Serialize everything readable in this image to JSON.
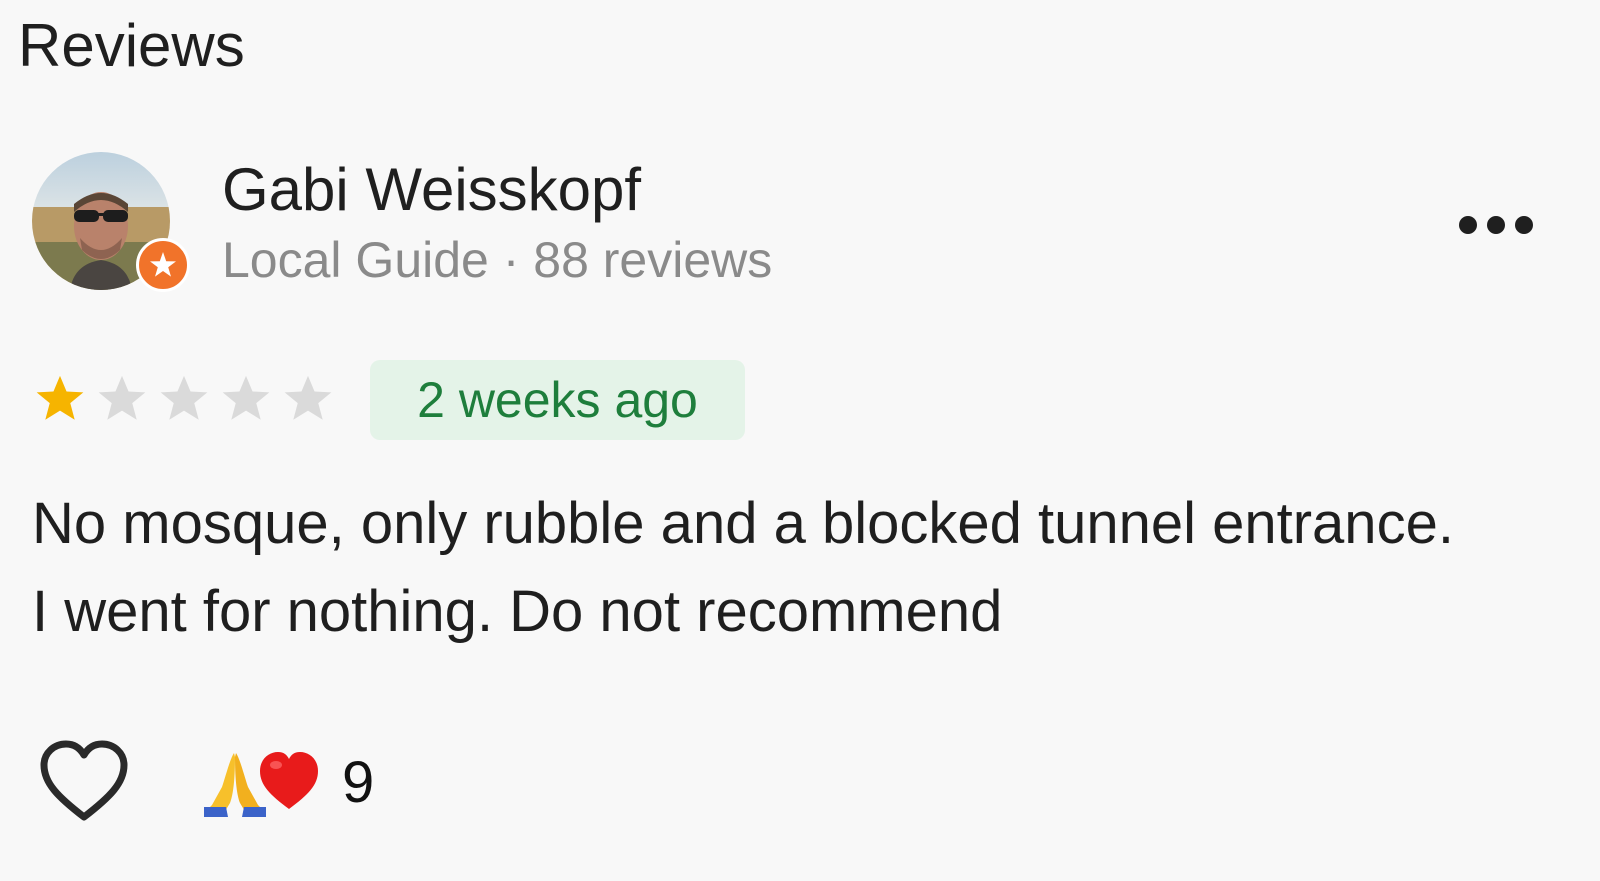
{
  "section_title": "Reviews",
  "review": {
    "reviewer_name": "Gabi Weisskopf",
    "reviewer_meta": "Local Guide · 88 reviews",
    "rating": 1,
    "rating_max": 5,
    "time_ago": "2 weeks ago",
    "text": "No mosque, only rubble and a blocked tunnel entrance. I went for nothing. Do not recommend",
    "reactions": {
      "emojis": [
        "folded-hands-emoji",
        "red-heart-emoji"
      ],
      "count": "9"
    }
  },
  "icons": {
    "more": "more-horizontal-icon",
    "like": "heart-outline-icon",
    "guide": "local-guide-badge-icon"
  },
  "colors": {
    "star_filled": "#f6b400",
    "star_empty": "#dadada",
    "time_badge_bg": "#e4f3e8",
    "time_badge_text": "#1e7e3c",
    "guide_badge": "#f1732a",
    "meta_text": "#8a8a8a"
  }
}
